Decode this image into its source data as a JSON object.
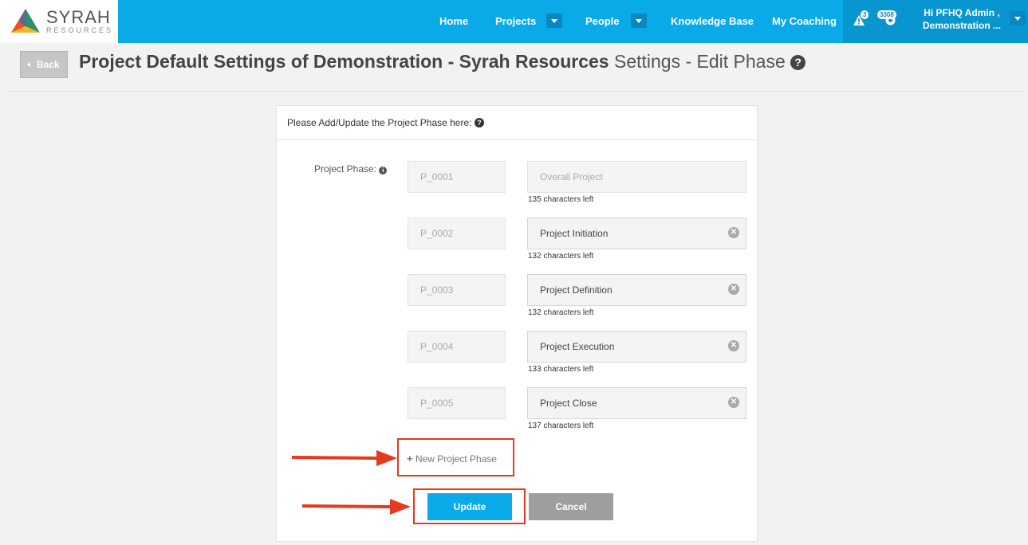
{
  "brand": {
    "name": "SYRAH",
    "sub": "RESOURCES"
  },
  "nav": {
    "home": "Home",
    "projects": "Projects",
    "people": "People",
    "knowledge_base": "Knowledge Base",
    "my_coaching": "My Coaching",
    "alerts_count": "3",
    "notifications_count": "3308",
    "user_line1": "Hi PFHQ Admin ,",
    "user_line2": "Demonstration ..."
  },
  "header": {
    "back_label": "Back",
    "title_bold": "Project Default Settings of Demonstration - Syrah Resources",
    "title_light": "Settings - Edit Phase",
    "help_glyph": "?"
  },
  "panel": {
    "heading": "Please Add/Update the Project Phase here:",
    "field_label": "Project Phase:",
    "phases": [
      {
        "code": "P_0001",
        "name": "Overall Project",
        "chars_left": "135 characters left"
      },
      {
        "code": "P_0002",
        "name": "Project Initiation",
        "chars_left": "132 characters left"
      },
      {
        "code": "P_0003",
        "name": "Project Definition",
        "chars_left": "132 characters left"
      },
      {
        "code": "P_0004",
        "name": "Project Execution",
        "chars_left": "133 characters left"
      },
      {
        "code": "P_0005",
        "name": "Project Close",
        "chars_left": "137 characters left"
      }
    ],
    "new_phase_label": "New Project Phase",
    "update_label": "Update",
    "cancel_label": "Cancel"
  },
  "colors": {
    "accent": "#0aa9e8",
    "highlight": "#e53a1d",
    "cancel": "#9e9e9e"
  },
  "icons": [
    "syrah-logo-icon",
    "alert-triangle-icon",
    "notification-icon",
    "chevron-down-icon",
    "help-icon",
    "info-icon",
    "clear-icon",
    "plus-icon",
    "arrow-icon"
  ]
}
